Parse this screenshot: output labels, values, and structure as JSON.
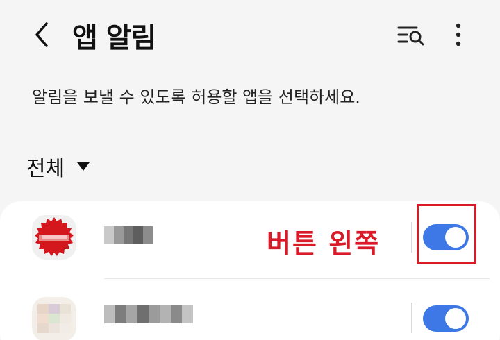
{
  "header": {
    "title": "앱 알림",
    "back_icon": "chevron-left-icon",
    "search_icon": "search-list-icon",
    "more_icon": "more-vertical-icon"
  },
  "description": "알림을 보낼 수 있도록 허용할 앱을 선택하세요.",
  "filter": {
    "label": "전체",
    "icon": "dropdown-triangle-icon"
  },
  "apps": [
    {
      "icon": "red-seal-app-icon",
      "name_blurred": true,
      "toggle_on": true
    },
    {
      "icon": "blurred-app-icon",
      "name_blurred": true,
      "toggle_on": true
    }
  ],
  "annotation": {
    "text": "버튼 왼쪽",
    "color": "#d81b27"
  },
  "colors": {
    "accent": "#3e78e6",
    "background": "#f5f5f5",
    "card": "#ffffff",
    "annotation": "#d81b27"
  }
}
